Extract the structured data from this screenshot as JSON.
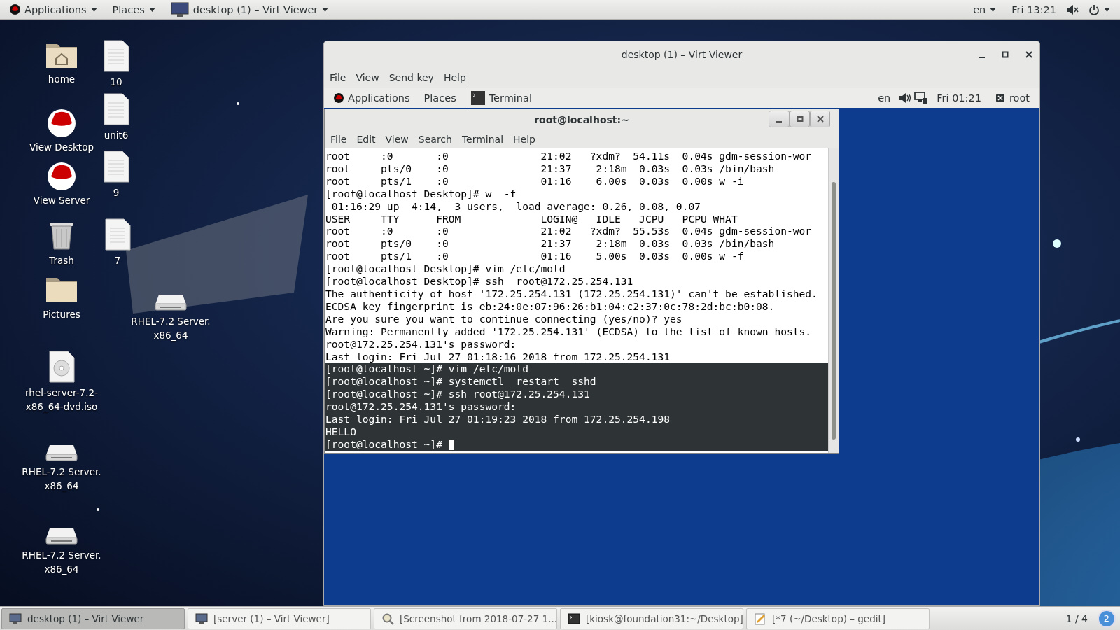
{
  "top_bar": {
    "menus": [
      "Applications",
      "Places"
    ],
    "window_button": "desktop (1) – Virt Viewer",
    "language": "en",
    "clock": "Fri 13:21"
  },
  "desktop_icons": [
    {
      "label": "home",
      "kind": "home"
    },
    {
      "label": "10",
      "kind": "file"
    },
    {
      "label": "View Desktop",
      "kind": "redhat"
    },
    {
      "label": "unit6",
      "kind": "file"
    },
    {
      "label": "View Server",
      "kind": "redhat"
    },
    {
      "label": "9",
      "kind": "file"
    },
    {
      "label": "Trash",
      "kind": "trash"
    },
    {
      "label": "7",
      "kind": "file"
    },
    {
      "label": "Pictures",
      "kind": "folder"
    },
    {
      "label": "RHEL-7.2 Server.\nx86_64",
      "kind": "drive"
    },
    {
      "label": "rhel-server-7.2-\nx86_64-dvd.iso",
      "kind": "disc"
    },
    {
      "label": "RHEL-7.2 Server.\nx86_64",
      "kind": "drive"
    },
    {
      "label": "RHEL-7.2 Server.\nx86_64",
      "kind": "drive"
    }
  ],
  "virt_viewer": {
    "title": "desktop (1) – Virt Viewer",
    "menu": [
      "File",
      "View",
      "Send key",
      "Help"
    ],
    "guest": {
      "top_bar": {
        "menus": [
          "Applications",
          "Places"
        ],
        "task": "Terminal",
        "language": "en",
        "clock": "Fri 01:21",
        "user": "root"
      },
      "terminal": {
        "title": "root@localhost:~",
        "menu": [
          "File",
          "Edit",
          "View",
          "Search",
          "Terminal",
          "Help"
        ],
        "lines": [
          {
            "text": "root     :0       :0               21:02   ?xdm?  54.11s  0.04s gdm-session-wor",
            "highlighted": false
          },
          {
            "text": "root     pts/0    :0               21:37    2:18m  0.03s  0.03s /bin/bash",
            "highlighted": false
          },
          {
            "text": "root     pts/1    :0               01:16    6.00s  0.03s  0.00s w -i",
            "highlighted": false
          },
          {
            "text": "[root@localhost Desktop]# w  -f",
            "highlighted": false
          },
          {
            "text": " 01:16:29 up  4:14,  3 users,  load average: 0.26, 0.08, 0.07",
            "highlighted": false
          },
          {
            "text": "USER     TTY      FROM             LOGIN@   IDLE   JCPU   PCPU WHAT",
            "highlighted": false
          },
          {
            "text": "root     :0       :0               21:02   ?xdm?  55.53s  0.04s gdm-session-wor",
            "highlighted": false
          },
          {
            "text": "root     pts/0    :0               21:37    2:18m  0.03s  0.03s /bin/bash",
            "highlighted": false
          },
          {
            "text": "root     pts/1    :0               01:16    5.00s  0.03s  0.00s w -f",
            "highlighted": false
          },
          {
            "text": "[root@localhost Desktop]# vim /etc/motd",
            "highlighted": false
          },
          {
            "text": "[root@localhost Desktop]# ssh  root@172.25.254.131",
            "highlighted": false
          },
          {
            "text": "The authenticity of host '172.25.254.131 (172.25.254.131)' can't be established.",
            "highlighted": false
          },
          {
            "text": "ECDSA key fingerprint is eb:24:0e:07:96:26:b1:04:c2:37:0c:78:2d:bc:b0:08.",
            "highlighted": false
          },
          {
            "text": "Are you sure you want to continue connecting (yes/no)? yes",
            "highlighted": false
          },
          {
            "text": "Warning: Permanently added '172.25.254.131' (ECDSA) to the list of known hosts.",
            "highlighted": false
          },
          {
            "text": "root@172.25.254.131's password:",
            "highlighted": false
          },
          {
            "text": "Last login: Fri Jul 27 01:18:16 2018 from 172.25.254.131",
            "highlighted": false
          },
          {
            "text": "[root@localhost ~]# vim /etc/motd",
            "highlighted": true
          },
          {
            "text": "[root@localhost ~]# systemctl  restart  sshd",
            "highlighted": true
          },
          {
            "text": "[root@localhost ~]# ssh root@172.25.254.131",
            "highlighted": true
          },
          {
            "text": "root@172.25.254.131's password:",
            "highlighted": true
          },
          {
            "text": "Last login: Fri Jul 27 01:19:23 2018 from 172.25.254.198",
            "highlighted": true
          },
          {
            "text": "HELLO",
            "highlighted": true
          },
          {
            "text": "[root@localhost ~]# ",
            "highlighted": true,
            "cursor": true
          }
        ]
      }
    }
  },
  "taskbar": {
    "items": [
      {
        "label": "desktop (1) – Virt Viewer",
        "selected": true,
        "kind": "monitor"
      },
      {
        "label": "[server (1) – Virt Viewer]",
        "selected": false,
        "kind": "monitor"
      },
      {
        "label": "[Screenshot from 2018-07-27 1...",
        "selected": false,
        "kind": "viewer"
      },
      {
        "label": "[kiosk@foundation31:~/Desktop]",
        "selected": false,
        "kind": "terminal"
      },
      {
        "label": "[*7 (~/Desktop) – gedit]",
        "selected": false,
        "kind": "editor"
      }
    ],
    "workspace": "1 / 4",
    "notifications": "2"
  }
}
